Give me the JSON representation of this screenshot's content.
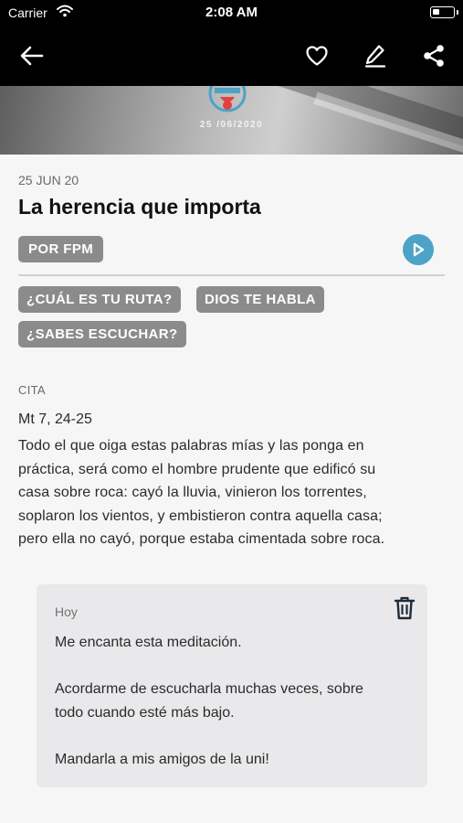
{
  "status_bar": {
    "carrier": "Carrier",
    "time": "2:08 AM"
  },
  "nav": {
    "icons": [
      "back-arrow-icon",
      "heart-icon",
      "edit-pencil-icon",
      "share-icon"
    ]
  },
  "hero": {
    "date": "25 /06/2020"
  },
  "article": {
    "date": "25 JUN 20",
    "title": "La herencia que importa",
    "author": "POR FPM",
    "tags": [
      "¿CUÁL ES TU RUTA?",
      "DIOS TE HABLA",
      "¿SABES ESCUCHAR?"
    ],
    "quote_label": "CITA",
    "quote_ref": "Mt 7, 24-25",
    "quote_lines": [
      "Todo el que oiga estas palabras mías y las ponga en",
      "práctica, será como el hombre prudente que edificó su",
      "casa sobre roca: cayó la lluvia, vinieron los torrentes,",
      "soplaron los vientos, y embistieron contra aquella casa;",
      "pero ella no cayó, porque estaba cimentada sobre roca."
    ]
  },
  "note": {
    "date": "Hoy",
    "paragraph1": "Me encanta esta meditación.",
    "paragraph2_lines": [
      "Acordarme de escucharla muchas veces, sobre",
      "todo cuando esté más bajo."
    ],
    "paragraph3": "Mandarla a mis amigos de la uni!"
  },
  "colors": {
    "accent": "#4da3c6",
    "chip": "#8b8b8b",
    "nav_bg": "#000000",
    "logo_red": "#e2413f"
  }
}
